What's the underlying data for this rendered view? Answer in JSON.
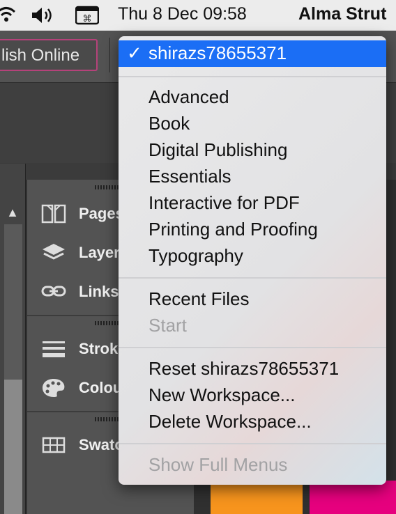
{
  "menubar": {
    "wifi_icon": "wifi-icon",
    "volume_icon": "speaker-volume-icon",
    "keyboard_icon": "keyboard-input-icon",
    "datetime": "Thu 8 Dec  09:58",
    "user": "Alma Strut"
  },
  "toolbar": {
    "publish_label": "lish Online"
  },
  "panels": {
    "items": [
      {
        "label": "Pages",
        "icon": "pages-icon"
      },
      {
        "label": "Layer",
        "icon": "layers-icon"
      },
      {
        "label": "Links",
        "icon": "links-icon"
      },
      {
        "label": "Strok",
        "icon": "stroke-icon"
      },
      {
        "label": "Colou",
        "icon": "colour-palette-icon"
      },
      {
        "label": "Swatc",
        "icon": "swatches-icon"
      }
    ]
  },
  "menu": {
    "selected": {
      "check": "✓",
      "label": "shirazs78655371"
    },
    "workspaces": [
      "Advanced",
      "Book",
      "Digital Publishing",
      "Essentials",
      "Interactive for PDF",
      "Printing and Proofing",
      "Typography"
    ],
    "recent_files": "Recent Files",
    "start": "Start",
    "reset": "Reset shirazs78655371",
    "new_workspace": "New Workspace...",
    "delete_workspace": "Delete Workspace...",
    "show_full_menus": "Show Full Menus"
  },
  "colors": {
    "selection": "#1b6ef5",
    "accent_border": "#b5427a",
    "swatch_orange": "#f7941d",
    "swatch_pink": "#e6007e"
  }
}
